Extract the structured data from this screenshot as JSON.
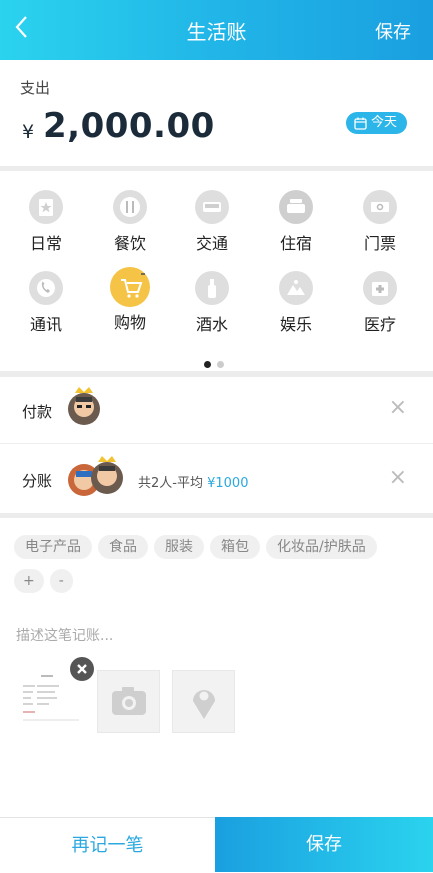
{
  "header": {
    "back_icon": "chevron-left-icon",
    "title": "生活账",
    "save_label": "保存"
  },
  "amount": {
    "type_label": "支出",
    "currency": "¥",
    "value": "2,000.00",
    "date_label": "今天",
    "date_icon": "calendar-icon"
  },
  "categories": [
    {
      "label": "日常",
      "icon": "star-icon"
    },
    {
      "label": "餐饮",
      "icon": "fork-knife-icon"
    },
    {
      "label": "交通",
      "icon": "car-icon"
    },
    {
      "label": "住宿",
      "icon": "bed-icon"
    },
    {
      "label": "门票",
      "icon": "ticket-icon"
    },
    {
      "label": "通讯",
      "icon": "phone-icon"
    },
    {
      "label": "购物",
      "icon": "cart-icon",
      "selected": true
    },
    {
      "label": "酒水",
      "icon": "bottle-icon"
    },
    {
      "label": "娱乐",
      "icon": "landscape-icon"
    },
    {
      "label": "医疗",
      "icon": "medical-kit-icon"
    }
  ],
  "pager": {
    "total": 2,
    "current": 1
  },
  "payment": {
    "label": "付款"
  },
  "split": {
    "label": "分账",
    "summary": "共2人-平均",
    "amount": "¥1000"
  },
  "tags": [
    "电子产品",
    "食品",
    "服装",
    "箱包",
    "化妆品/护肤品",
    "+",
    "-"
  ],
  "description_placeholder": "描述这笔记账...",
  "colors": {
    "accent": "#2bb5e9",
    "selected_category": "#f5c446"
  },
  "bottom": {
    "again_label": "再记一笔",
    "save_label": "保存"
  }
}
